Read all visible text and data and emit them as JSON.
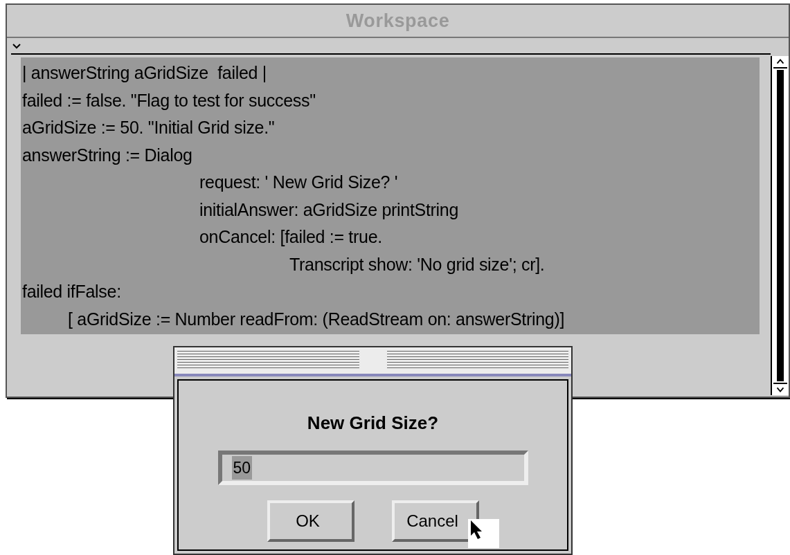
{
  "window": {
    "title": "Workspace",
    "active": false
  },
  "code": {
    "selected": true,
    "lines": [
      {
        "kind": "line",
        "text": "| answerString aGridSize  failed |"
      },
      {
        "kind": "line",
        "text": "failed := false. \"Flag to test for success\""
      },
      {
        "kind": "line",
        "text": "aGridSize := 50. \"Initial Grid size.\""
      },
      {
        "kind": "line",
        "text": "answerString := Dialog"
      },
      {
        "kind": "arg",
        "text": "request: ' New Grid Size? '"
      },
      {
        "kind": "arg",
        "text": "initialAnswer: aGridSize printString"
      },
      {
        "kind": "arg",
        "text": "onCancel: [failed := true."
      },
      {
        "kind": "nested",
        "text": "Transcript show: 'No grid size'; cr]."
      },
      {
        "kind": "line",
        "text": "failed ifFalse:"
      },
      {
        "kind": "block",
        "text": "[ aGridSize := Number readFrom: (ReadStream on: answerString)]"
      }
    ]
  },
  "dialog": {
    "prompt": "New Grid Size?",
    "input": {
      "value": "50",
      "selected": true
    },
    "buttons": [
      "OK",
      "Cancel"
    ]
  }
}
